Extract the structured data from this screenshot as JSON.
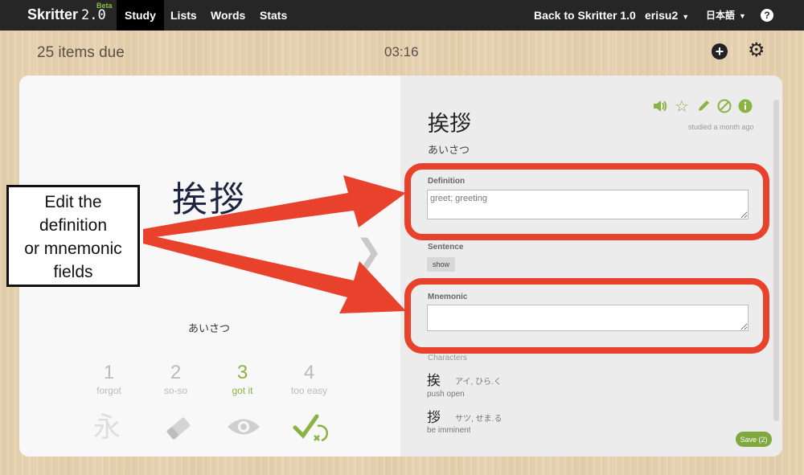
{
  "navbar": {
    "logo": "Skritter",
    "version": "2.0",
    "beta": "Beta",
    "items": [
      "Study",
      "Lists",
      "Words",
      "Stats"
    ],
    "back_link": "Back to Skritter 1.0",
    "user": "erisu2",
    "language": "日本語",
    "help": "?"
  },
  "status": {
    "due": "25 items due",
    "timer": "03:16"
  },
  "left": {
    "word": "挨拶",
    "reading": "あいさつ",
    "next_icon": "chevron-right-icon",
    "grades": [
      {
        "num": "1",
        "label": "forgot"
      },
      {
        "num": "2",
        "label": "so-so"
      },
      {
        "num": "3",
        "label": "got it"
      },
      {
        "num": "4",
        "label": "too easy"
      }
    ],
    "active_grade": "3",
    "tools": [
      "stroke-order-icon",
      "eraser-icon",
      "eye-icon",
      "check-next-icon"
    ],
    "accent_color": "#8bb344"
  },
  "right": {
    "word": "挨拶",
    "reading": "あいさつ",
    "studied": "studied a month ago",
    "action_icons": [
      "audio-icon",
      "star-icon",
      "pencil-icon",
      "ban-icon",
      "info-icon"
    ],
    "definition_label": "Definition",
    "definition_value": "greet; greeting",
    "sentence_label": "Sentence",
    "show_label": "show",
    "mnemonic_label": "Mnemonic",
    "mnemonic_value": "",
    "characters_label": "Characters",
    "characters": [
      {
        "glyph": "挨",
        "reading": "アイ, ひら.く",
        "meaning": "push open"
      },
      {
        "glyph": "拶",
        "reading": "サツ, せま.る",
        "meaning": "be imminent"
      }
    ],
    "save_label": "Save (2)"
  },
  "annotation": {
    "lines": [
      "Edit the",
      "definition",
      "or mnemonic",
      "fields"
    ],
    "color": "#e8412c"
  }
}
